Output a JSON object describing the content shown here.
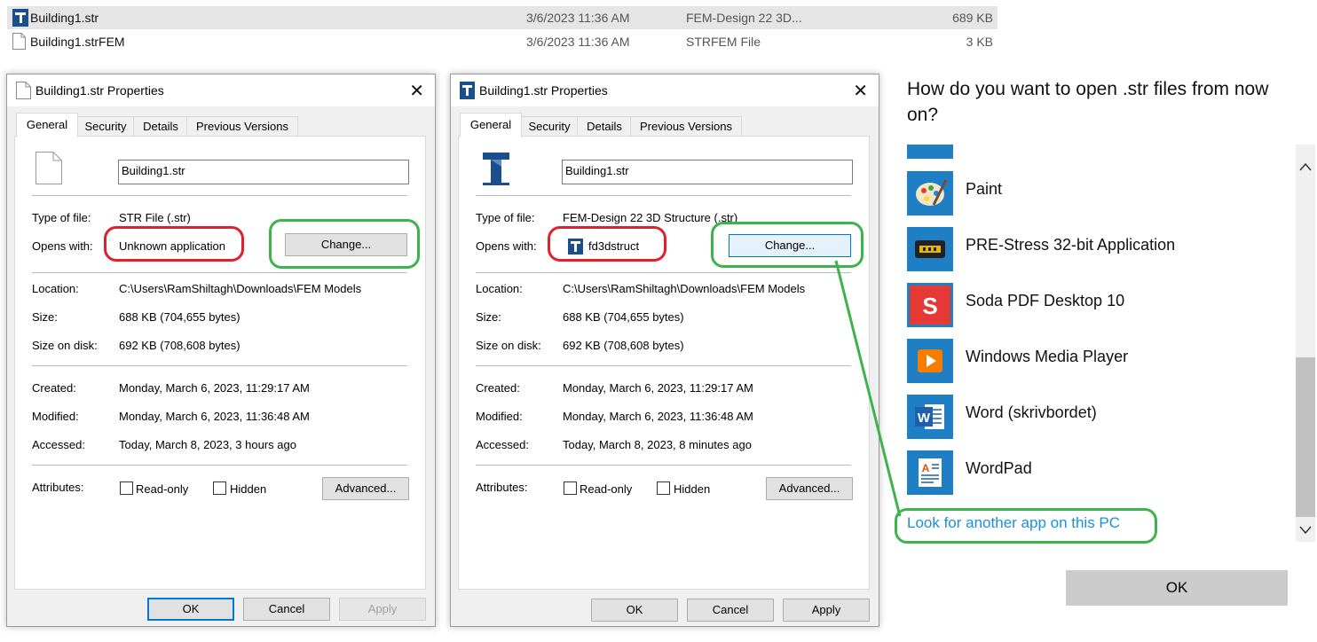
{
  "explorer": {
    "rows": [
      {
        "name": "Building1.str",
        "date": "3/6/2023 11:36 AM",
        "type": "FEM-Design 22 3D...",
        "size": "689 KB"
      },
      {
        "name": "Building1.strFEM",
        "date": "3/6/2023 11:36 AM",
        "type": "STRFEM File",
        "size": "3 KB"
      }
    ]
  },
  "dialog_left": {
    "title": "Building1.str Properties",
    "close": "✕",
    "tabs": [
      "General",
      "Security",
      "Details",
      "Previous Versions"
    ],
    "filename": "Building1.str",
    "type_label": "Type of file:",
    "type_value": "STR File (.str)",
    "opens_label": "Opens with:",
    "opens_value": "Unknown application",
    "change": "Change...",
    "location_label": "Location:",
    "location_value": "C:\\Users\\RamShiltagh\\Downloads\\FEM Models",
    "size_label": "Size:",
    "size_value": "688 KB (704,655 bytes)",
    "disk_label": "Size on disk:",
    "disk_value": "692 KB (708,608 bytes)",
    "created_label": "Created:",
    "created_value": "Monday, March 6, 2023, 11:29:17 AM",
    "modified_label": "Modified:",
    "modified_value": "Monday, March 6, 2023, 11:36:48 AM",
    "accessed_label": "Accessed:",
    "accessed_value": "Today, March 8, 2023, 3 hours ago",
    "attributes_label": "Attributes:",
    "readonly": "Read-only",
    "hidden": "Hidden",
    "advanced": "Advanced...",
    "ok": "OK",
    "cancel": "Cancel",
    "apply": "Apply"
  },
  "dialog_right": {
    "title": "Building1.str Properties",
    "close": "✕",
    "tabs": [
      "General",
      "Security",
      "Details",
      "Previous Versions"
    ],
    "filename": "Building1.str",
    "type_label": "Type of file:",
    "type_value": "FEM-Design 22 3D Structure (.str)",
    "opens_label": "Opens with:",
    "opens_value": "fd3dstruct",
    "change": "Change...",
    "location_label": "Location:",
    "location_value": "C:\\Users\\RamShiltagh\\Downloads\\FEM Models",
    "size_label": "Size:",
    "size_value": "688 KB (704,655 bytes)",
    "disk_label": "Size on disk:",
    "disk_value": "692 KB (708,608 bytes)",
    "created_label": "Created:",
    "created_value": "Monday, March 6, 2023, 11:29:17 AM",
    "modified_label": "Modified:",
    "modified_value": "Monday, March 6, 2023, 11:36:48 AM",
    "accessed_label": "Accessed:",
    "accessed_value": "Today, March 8, 2023, 8 minutes ago",
    "attributes_label": "Attributes:",
    "readonly": "Read-only",
    "hidden": "Hidden",
    "advanced": "Advanced...",
    "ok": "OK",
    "cancel": "Cancel",
    "apply": "Apply"
  },
  "open_with": {
    "title": "How do you want to open .str files from now on?",
    "apps": [
      {
        "name": "Paint",
        "icon": "paint-icon"
      },
      {
        "name": "PRE-Stress 32-bit Application",
        "icon": "prestress-icon"
      },
      {
        "name": "Soda PDF Desktop 10",
        "icon": "soda-pdf-icon"
      },
      {
        "name": "Windows Media Player",
        "icon": "media-player-icon"
      },
      {
        "name": "Word (skrivbordet)",
        "icon": "word-icon"
      },
      {
        "name": "WordPad",
        "icon": "wordpad-icon"
      }
    ],
    "link": "Look for another app on this PC",
    "ok": "OK"
  },
  "colors": {
    "highlight_red": "#e0202c",
    "highlight_green": "#3cb44b",
    "link": "#1a90d8",
    "accent": "#0078d7"
  }
}
